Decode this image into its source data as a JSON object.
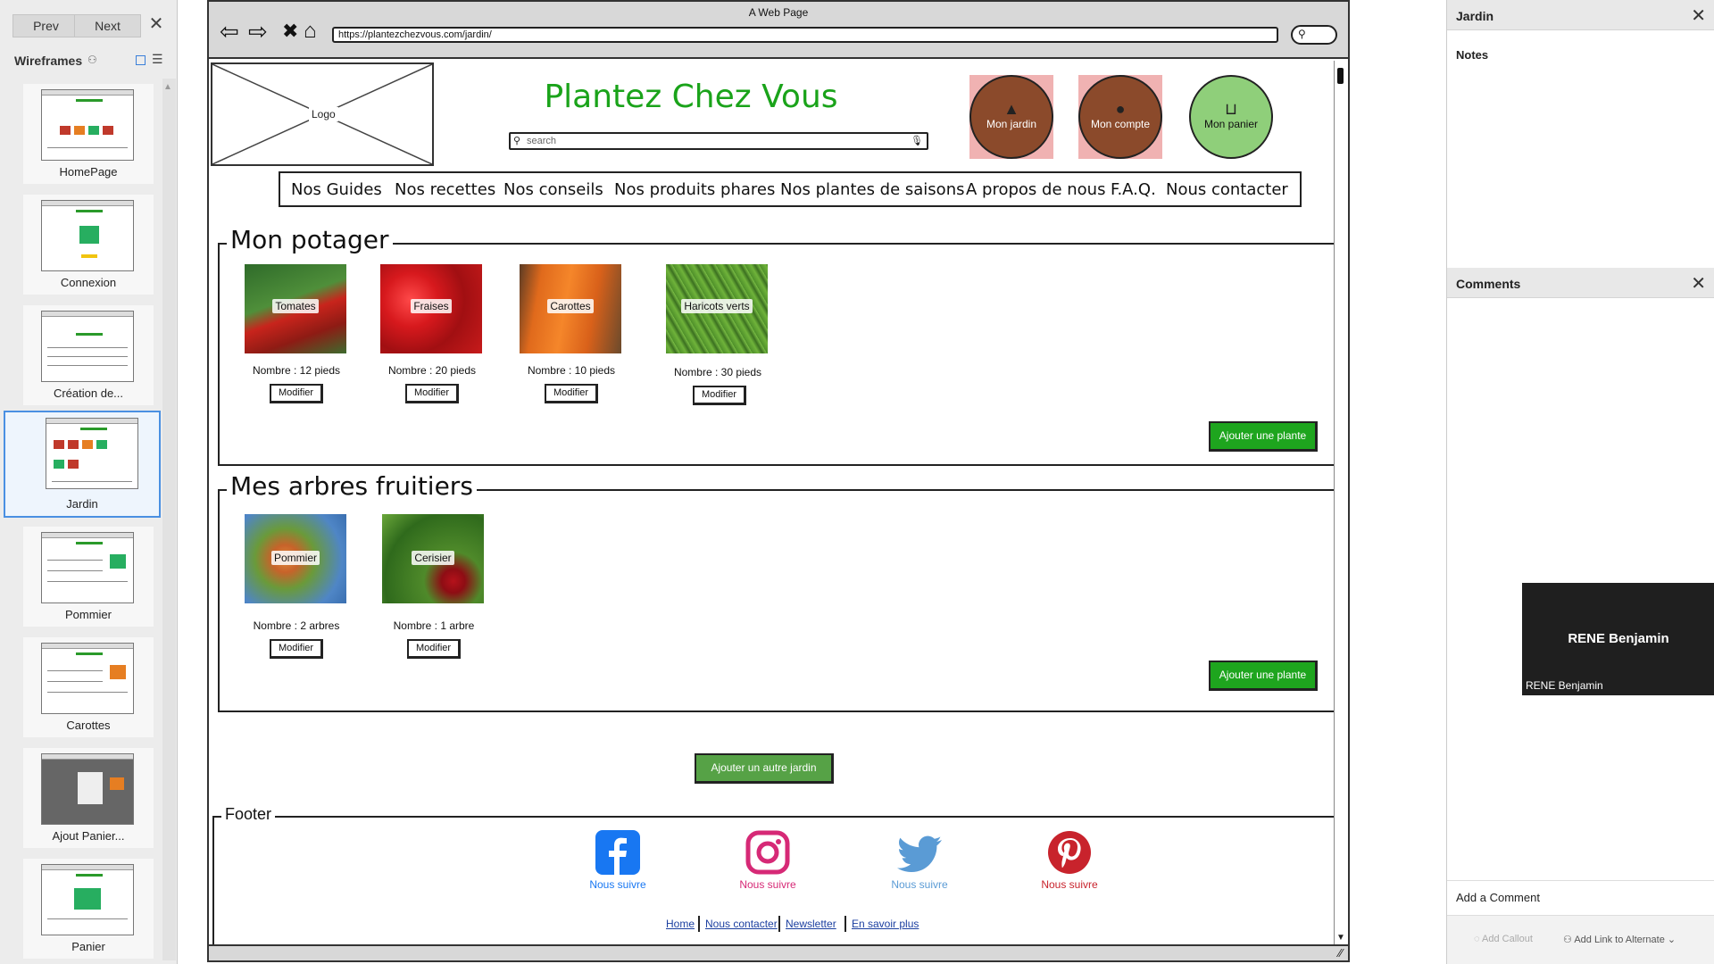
{
  "left_panel": {
    "prev_label": "Prev",
    "next_label": "Next",
    "section_title": "Wireframes",
    "pages": [
      {
        "label": "HomePage",
        "selected": false
      },
      {
        "label": "Connexion",
        "selected": false
      },
      {
        "label": "Création de...",
        "selected": false
      },
      {
        "label": "Jardin",
        "selected": true
      },
      {
        "label": "Pommier",
        "selected": false
      },
      {
        "label": "Carottes",
        "selected": false
      },
      {
        "label": "Ajout Panier...",
        "selected": false
      },
      {
        "label": "Panier",
        "selected": false
      }
    ]
  },
  "browser": {
    "window_title": "A Web Page",
    "url": "https://plantezchezvous.com/jardin/"
  },
  "site": {
    "logo_label": "Logo",
    "title": "Plantez Chez Vous",
    "search_placeholder": "search",
    "account_buttons": [
      {
        "label": "Mon jardin",
        "icon": "tree-icon"
      },
      {
        "label": "Mon compte",
        "icon": "user-icon"
      },
      {
        "label": "Mon panier",
        "icon": "basket-icon"
      }
    ],
    "menu": [
      "Nos Guides",
      "Nos recettes",
      "Nos conseils",
      "Nos produits phares",
      "Nos plantes de saisons",
      "A propos de nous",
      "F.A.Q.",
      "Nous contacter"
    ]
  },
  "potager": {
    "title": "Mon potager",
    "plants": [
      {
        "name": "Tomates",
        "count": "Nombre : 12 pieds",
        "button": "Modifier"
      },
      {
        "name": "Fraises",
        "count": "Nombre : 20 pieds",
        "button": "Modifier"
      },
      {
        "name": "Carottes",
        "count": "Nombre : 10 pieds",
        "button": "Modifier"
      },
      {
        "name": "Haricots verts",
        "count": "Nombre : 30 pieds",
        "button": "Modifier"
      }
    ],
    "add_button": "Ajouter une plante"
  },
  "fruitiers": {
    "title": "Mes arbres fruitiers",
    "plants": [
      {
        "name": "Pommier",
        "count": "Nombre : 2 arbres",
        "button": "Modifier"
      },
      {
        "name": "Cerisier",
        "count": "Nombre : 1 arbre",
        "button": "Modifier"
      }
    ],
    "add_button": "Ajouter une plante"
  },
  "add_garden_button": "Ajouter un autre jardin",
  "footer": {
    "title": "Footer",
    "socials": [
      {
        "icon": "facebook-icon",
        "label": "Nous suivre",
        "color": "#1877f2"
      },
      {
        "icon": "instagram-icon",
        "label": "Nous suivre",
        "color": "#d62976"
      },
      {
        "icon": "twitter-icon",
        "label": "Nous suivre",
        "color": "#5a9bd5"
      },
      {
        "icon": "pinterest-icon",
        "label": "Nous suivre",
        "color": "#c8232c"
      }
    ],
    "links": [
      "Home",
      "Nous contacter",
      "Newsletter",
      "En savoir plus"
    ]
  },
  "right_panel": {
    "page_title": "Jardin",
    "notes_label": "Notes",
    "comments_title": "Comments",
    "user_name_large": "RENE Benjamin",
    "user_name_small": "RENE Benjamin",
    "add_comment": "Add a Comment",
    "add_callout": "Add Callout",
    "add_link": "Add Link to Alternate"
  },
  "colors": {
    "site_title": "#1aa31a",
    "primary_button": "#1ea51e",
    "secondary_button": "#56a246",
    "account_button_bg": "#f0b2b2",
    "account_button_fill": "#8b4a2b",
    "basket_button_fill": "#8fcf7a",
    "selection": "#4a90e2"
  }
}
